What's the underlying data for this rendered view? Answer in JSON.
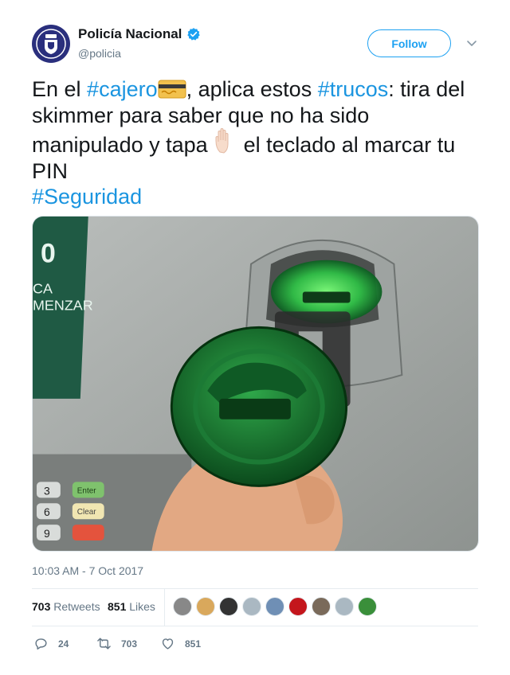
{
  "user": {
    "display_name": "Policía Nacional",
    "handle": "@policia",
    "verified_icon": "verified-badge-icon",
    "avatar_icon": "police-crest-icon"
  },
  "follow_label": "Follow",
  "tweet": {
    "part1": "En el ",
    "hashtag1": "#cajero",
    "emoji1": "credit-card-emoji",
    "part2": ", aplica estos ",
    "hashtag2": "#trucos",
    "part3": ": tira del skimmer para saber que no ha sido manipulado y tapa ",
    "emoji2": "raised-hand-emoji",
    "part4": " el teclado al marcar tu PIN",
    "hashtag3": "#Seguridad"
  },
  "media": {
    "screen_text_1": "0",
    "screen_text_2": "CA",
    "screen_text_3": "MENZAR",
    "keypad_keys": [
      "3",
      "6",
      "9",
      "Enter",
      "Clear"
    ]
  },
  "timestamp": "10:03 AM - 7 Oct 2017",
  "stats": {
    "retweets_count": "703",
    "retweets_label": "Retweets",
    "likes_count": "851",
    "likes_label": "Likes",
    "liker_colors": [
      "#888888",
      "#d9a85c",
      "#333333",
      "#aab8c2",
      "#6f8fb5",
      "#c4161c",
      "#7a6a5a",
      "#aab8c2",
      "#3a8f3a"
    ]
  },
  "actions": {
    "reply_count": "24",
    "retweet_count": "703",
    "like_count": "851"
  },
  "colors": {
    "accent": "#1da1f2",
    "hashtag": "#1b95e0",
    "muted": "#657786"
  }
}
